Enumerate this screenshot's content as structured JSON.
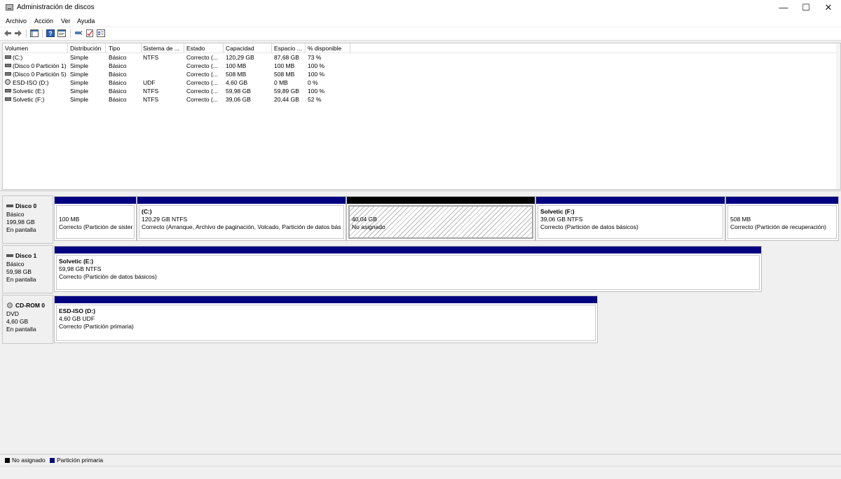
{
  "window": {
    "title": "Administración de discos"
  },
  "menu": [
    "Archivo",
    "Acción",
    "Ver",
    "Ayuda"
  ],
  "toolbar": {
    "icons": [
      "back-arrow-icon",
      "forward-arrow-icon",
      "console-tree-icon",
      "help-icon",
      "properties-icon",
      "connect-icon",
      "check-icon",
      "view-icon"
    ]
  },
  "volume_list": {
    "columns": [
      "Volumen",
      "Distribución",
      "Tipo",
      "Sistema de ...",
      "Estado",
      "Capacidad",
      "Espacio ...",
      "% disponible"
    ],
    "rows": [
      {
        "icon": "disk",
        "volume": "(C:)",
        "layout": "Simple",
        "type": "Básico",
        "fs": "NTFS",
        "status": "Correcto (...",
        "capacity": "120,29 GB",
        "free": "87,68 GB",
        "pct": "73 %"
      },
      {
        "icon": "disk",
        "volume": "(Disco 0 Partición 1)",
        "layout": "Simple",
        "type": "Básico",
        "fs": "",
        "status": "Correcto (...",
        "capacity": "100 MB",
        "free": "100 MB",
        "pct": "100 %"
      },
      {
        "icon": "disk",
        "volume": "(Disco 0 Partición 5)",
        "layout": "Simple",
        "type": "Básico",
        "fs": "",
        "status": "Correcto (...",
        "capacity": "508 MB",
        "free": "508 MB",
        "pct": "100 %"
      },
      {
        "icon": "cd",
        "volume": "ESD-ISO (D:)",
        "layout": "Simple",
        "type": "Básico",
        "fs": "UDF",
        "status": "Correcto (...",
        "capacity": "4,60 GB",
        "free": "0 MB",
        "pct": "0 %"
      },
      {
        "icon": "disk",
        "volume": "Solvetic (E:)",
        "layout": "Simple",
        "type": "Básico",
        "fs": "NTFS",
        "status": "Correcto (...",
        "capacity": "59,98 GB",
        "free": "59,89 GB",
        "pct": "100 %"
      },
      {
        "icon": "disk",
        "volume": "Solvetic (F:)",
        "layout": "Simple",
        "type": "Básico",
        "fs": "NTFS",
        "status": "Correcto (...",
        "capacity": "39,06 GB",
        "free": "20,44 GB",
        "pct": "52 %"
      }
    ]
  },
  "disks": [
    {
      "name": "Disco 0",
      "icon": "disk",
      "type": "Básico",
      "size": "199,98 GB",
      "state": "En pantalla",
      "partitions": [
        {
          "name": "",
          "size": "100 MB",
          "status": "Correcto (Partición de sister",
          "bar": "primary"
        },
        {
          "name": "(C:)",
          "size": "120,29 GB NTFS",
          "status": "Correcto (Arranque, Archivo de paginación, Volcado, Partición de datos bás",
          "bar": "primary"
        },
        {
          "name": "",
          "size": "40,04 GB",
          "status": "No asignado",
          "bar": "unallocated"
        },
        {
          "name": "Solvetic  (F:)",
          "size": "39,06 GB NTFS",
          "status": "Correcto (Partición de datos básicos)",
          "bar": "primary"
        },
        {
          "name": "",
          "size": "508 MB",
          "status": "Correcto (Partición de recuperación)",
          "bar": "primary"
        }
      ]
    },
    {
      "name": "Disco 1",
      "icon": "disk",
      "type": "Básico",
      "size": "59,98 GB",
      "state": "En pantalla",
      "partitions": [
        {
          "name": "Solvetic  (E:)",
          "size": "59,98 GB NTFS",
          "status": "Correcto (Partición de datos básicos)",
          "bar": "primary"
        }
      ]
    },
    {
      "name": "CD-ROM 0",
      "icon": "cd",
      "type": "DVD",
      "size": "4,60 GB",
      "state": "En pantalla",
      "partitions": [
        {
          "name": "ESD-ISO  (D:)",
          "size": "4,60 GB UDF",
          "status": "Correcto (Partición primaria)",
          "bar": "primary"
        }
      ]
    }
  ],
  "legend": [
    {
      "label": "No asignado",
      "color": "#000000"
    },
    {
      "label": "Partición primaria",
      "color": "#000080"
    }
  ]
}
